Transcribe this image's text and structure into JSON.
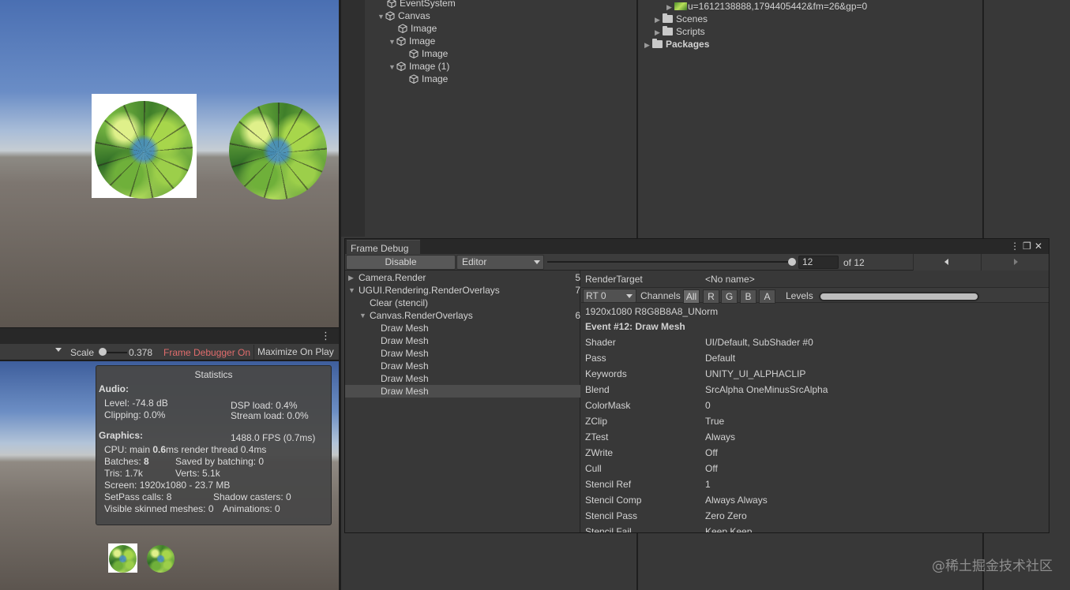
{
  "hierarchy": {
    "items": [
      {
        "label": "EventSystem"
      },
      {
        "label": "Canvas"
      },
      {
        "label": "Image"
      },
      {
        "label": "Image"
      },
      {
        "label": "Image"
      },
      {
        "label": "Image (1)"
      },
      {
        "label": "Image"
      }
    ]
  },
  "project": {
    "items": [
      {
        "label": "u=1612138888,1794405442&fm=26&gp=0"
      },
      {
        "label": "Scenes"
      },
      {
        "label": "Scripts"
      },
      {
        "label": "Packages"
      }
    ]
  },
  "game_toolbar": {
    "menu_icon": "more-vertical-icon",
    "scale_label": "Scale",
    "scale_value": "0.378",
    "scale_fraction": 0.1,
    "frame_debugger_label": "Frame Debugger On",
    "frame_debugger_color": "#e06c6c",
    "maximize_label": "Maximize On Play"
  },
  "statistics": {
    "title": "Statistics",
    "audio_heading": "Audio:",
    "level": "Level: -74.8 dB",
    "dsp_load": "DSP load: 0.4%",
    "clipping": "Clipping: 0.0%",
    "stream_load": "Stream load: 0.0%",
    "graphics_heading": "Graphics:",
    "fps": "1488.0 FPS (0.7ms)",
    "cpu_prefix": "CPU: main ",
    "cpu_main": "0.6",
    "cpu_suffix": "ms  render thread 0.4ms",
    "batches_prefix": "Batches: ",
    "batches_value": "8",
    "saved_by_batching": "Saved by batching: 0",
    "tris": "Tris: 1.7k",
    "verts": "Verts: 5.1k",
    "screen": "Screen: 1920x1080 - 23.7 MB",
    "setpass": "SetPass calls: 8",
    "shadow_casters": "Shadow casters: 0",
    "skinned_meshes": "Visible skinned meshes: 0",
    "animations": "Animations: 0"
  },
  "frame_debug": {
    "tab_label": "Frame Debug",
    "window_icons": [
      "more-vertical-icon",
      "maximize-icon",
      "close-icon"
    ],
    "disable_label": "Disable",
    "target_dropdown": "Editor",
    "event_index": "12",
    "of_total": "of 12",
    "slider_fraction": 1.0,
    "prev_icon": "triangle-left-icon",
    "next_icon": "triangle-right-icon",
    "events": [
      {
        "label": "Camera.Render",
        "count": "5"
      },
      {
        "label": "UGUI.Rendering.RenderOverlays",
        "count": "7"
      },
      {
        "label": "Clear (stencil)",
        "count": ""
      },
      {
        "label": "Canvas.RenderOverlays",
        "count": "6"
      },
      {
        "label": "Draw Mesh",
        "count": ""
      },
      {
        "label": "Draw Mesh",
        "count": ""
      },
      {
        "label": "Draw Mesh",
        "count": ""
      },
      {
        "label": "Draw Mesh",
        "count": ""
      },
      {
        "label": "Draw Mesh",
        "count": ""
      },
      {
        "label": "Draw Mesh",
        "count": ""
      }
    ],
    "selected_event_index": 9,
    "render_target_label": "RenderTarget",
    "render_target_value": "<No name>",
    "rt_dropdown": "RT 0",
    "channels_label": "Channels",
    "channels": [
      "All",
      "R",
      "G",
      "B",
      "A"
    ],
    "selected_channel": "All",
    "levels_label": "Levels",
    "format": "1920x1080 R8G8B8A8_UNorm",
    "event_title": "Event #12: Draw Mesh",
    "properties": [
      {
        "name": "Shader",
        "value": "UI/Default, SubShader #0"
      },
      {
        "name": "Pass",
        "value": "Default"
      },
      {
        "name": "Keywords",
        "value": "UNITY_UI_ALPHACLIP"
      },
      {
        "name": "Blend",
        "value": "SrcAlpha OneMinusSrcAlpha"
      },
      {
        "name": "ColorMask",
        "value": "0"
      },
      {
        "name": "ZClip",
        "value": "True"
      },
      {
        "name": "ZTest",
        "value": "Always"
      },
      {
        "name": "ZWrite",
        "value": "Off"
      },
      {
        "name": "Cull",
        "value": "Off"
      },
      {
        "name": "Stencil Ref",
        "value": "1"
      },
      {
        "name": "Stencil Comp",
        "value": "Always Always"
      },
      {
        "name": "Stencil Pass",
        "value": "Zero Zero"
      },
      {
        "name": "Stencil Fail",
        "value": "Keep Keep"
      }
    ]
  },
  "watermark": "@稀土掘金技术社区"
}
